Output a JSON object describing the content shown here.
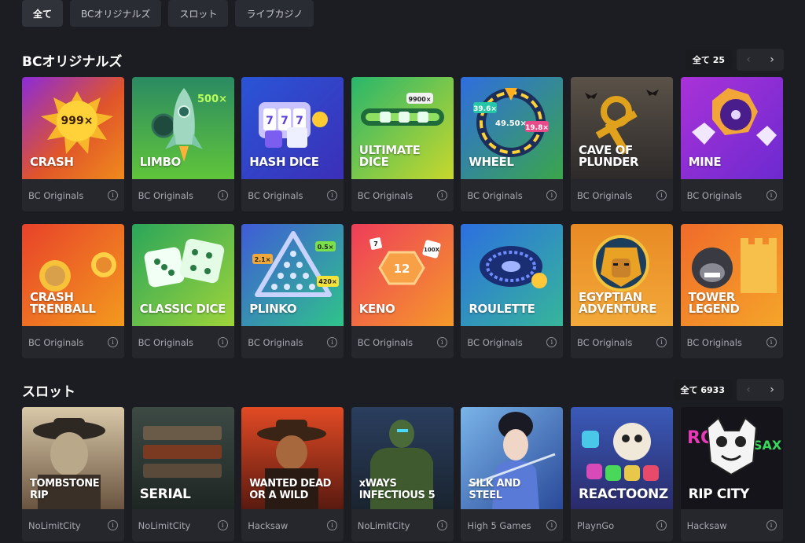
{
  "tabs": [
    {
      "label": "全て",
      "active": true
    },
    {
      "label": "BCオリジナルズ",
      "active": false
    },
    {
      "label": "スロット",
      "active": false
    },
    {
      "label": "ライブカジノ",
      "active": false
    }
  ],
  "originals": {
    "title": "BCオリジナルズ",
    "count_label": "全て 25",
    "prev_icon": "chevron-left-icon",
    "next_icon": "chevron-right-icon",
    "games": [
      {
        "title": "CRASH",
        "badge": "999×",
        "provider": "BC Originals"
      },
      {
        "title": "LIMBO",
        "badge": "500×",
        "provider": "BC Originals"
      },
      {
        "title": "HASH DICE",
        "provider": "BC Originals"
      },
      {
        "title": "ULTIMATE\nDICE",
        "badge": "9900×",
        "provider": "BC Originals"
      },
      {
        "title": "WHEEL",
        "badges": [
          "39.6×",
          "49.50×",
          "19.8×"
        ],
        "provider": "BC Originals"
      },
      {
        "title": "CAVE OF\nPLUNDER",
        "provider": "BC Originals"
      },
      {
        "title": "MINE",
        "provider": "BC Originals"
      },
      {
        "title": "CRASH\nTRENBALL",
        "provider": "BC Originals"
      },
      {
        "title": "CLASSIC DICE",
        "provider": "BC Originals"
      },
      {
        "title": "PLINKO",
        "badges": [
          "2.1×",
          "0.5×",
          "420×"
        ],
        "provider": "BC Originals"
      },
      {
        "title": "KENO",
        "badges": [
          "12",
          "100X",
          "7"
        ],
        "provider": "BC Originals"
      },
      {
        "title": "ROULETTE",
        "provider": "BC Originals"
      },
      {
        "title": "EGYPTIAN\nADVENTURE",
        "provider": "BC Originals"
      },
      {
        "title": "TOWER\nLEGEND",
        "provider": "BC Originals"
      }
    ]
  },
  "slots": {
    "title": "スロット",
    "count_label": "全て 6933",
    "games": [
      {
        "title": "TOMBSTONE\nRIP",
        "provider": "NoLimitCity"
      },
      {
        "title": "SERIAL",
        "provider": "NoLimitCity"
      },
      {
        "title": "WANTED DEAD\nOR A WILD",
        "provider": "Hacksaw"
      },
      {
        "title": "xWAYS\nINFECTIOUS 5",
        "provider": "NoLimitCity"
      },
      {
        "title": "SILK AND\nSTEEL",
        "provider": "High 5 Games"
      },
      {
        "title": "REACTOONZ",
        "provider": "PlaynGo"
      },
      {
        "title": "RIP CITY",
        "provider": "Hacksaw"
      }
    ]
  },
  "info_icon": "info-icon",
  "colors": {
    "background": "#1c1d22",
    "card": "#25272d",
    "tab": "#2a2c33"
  }
}
